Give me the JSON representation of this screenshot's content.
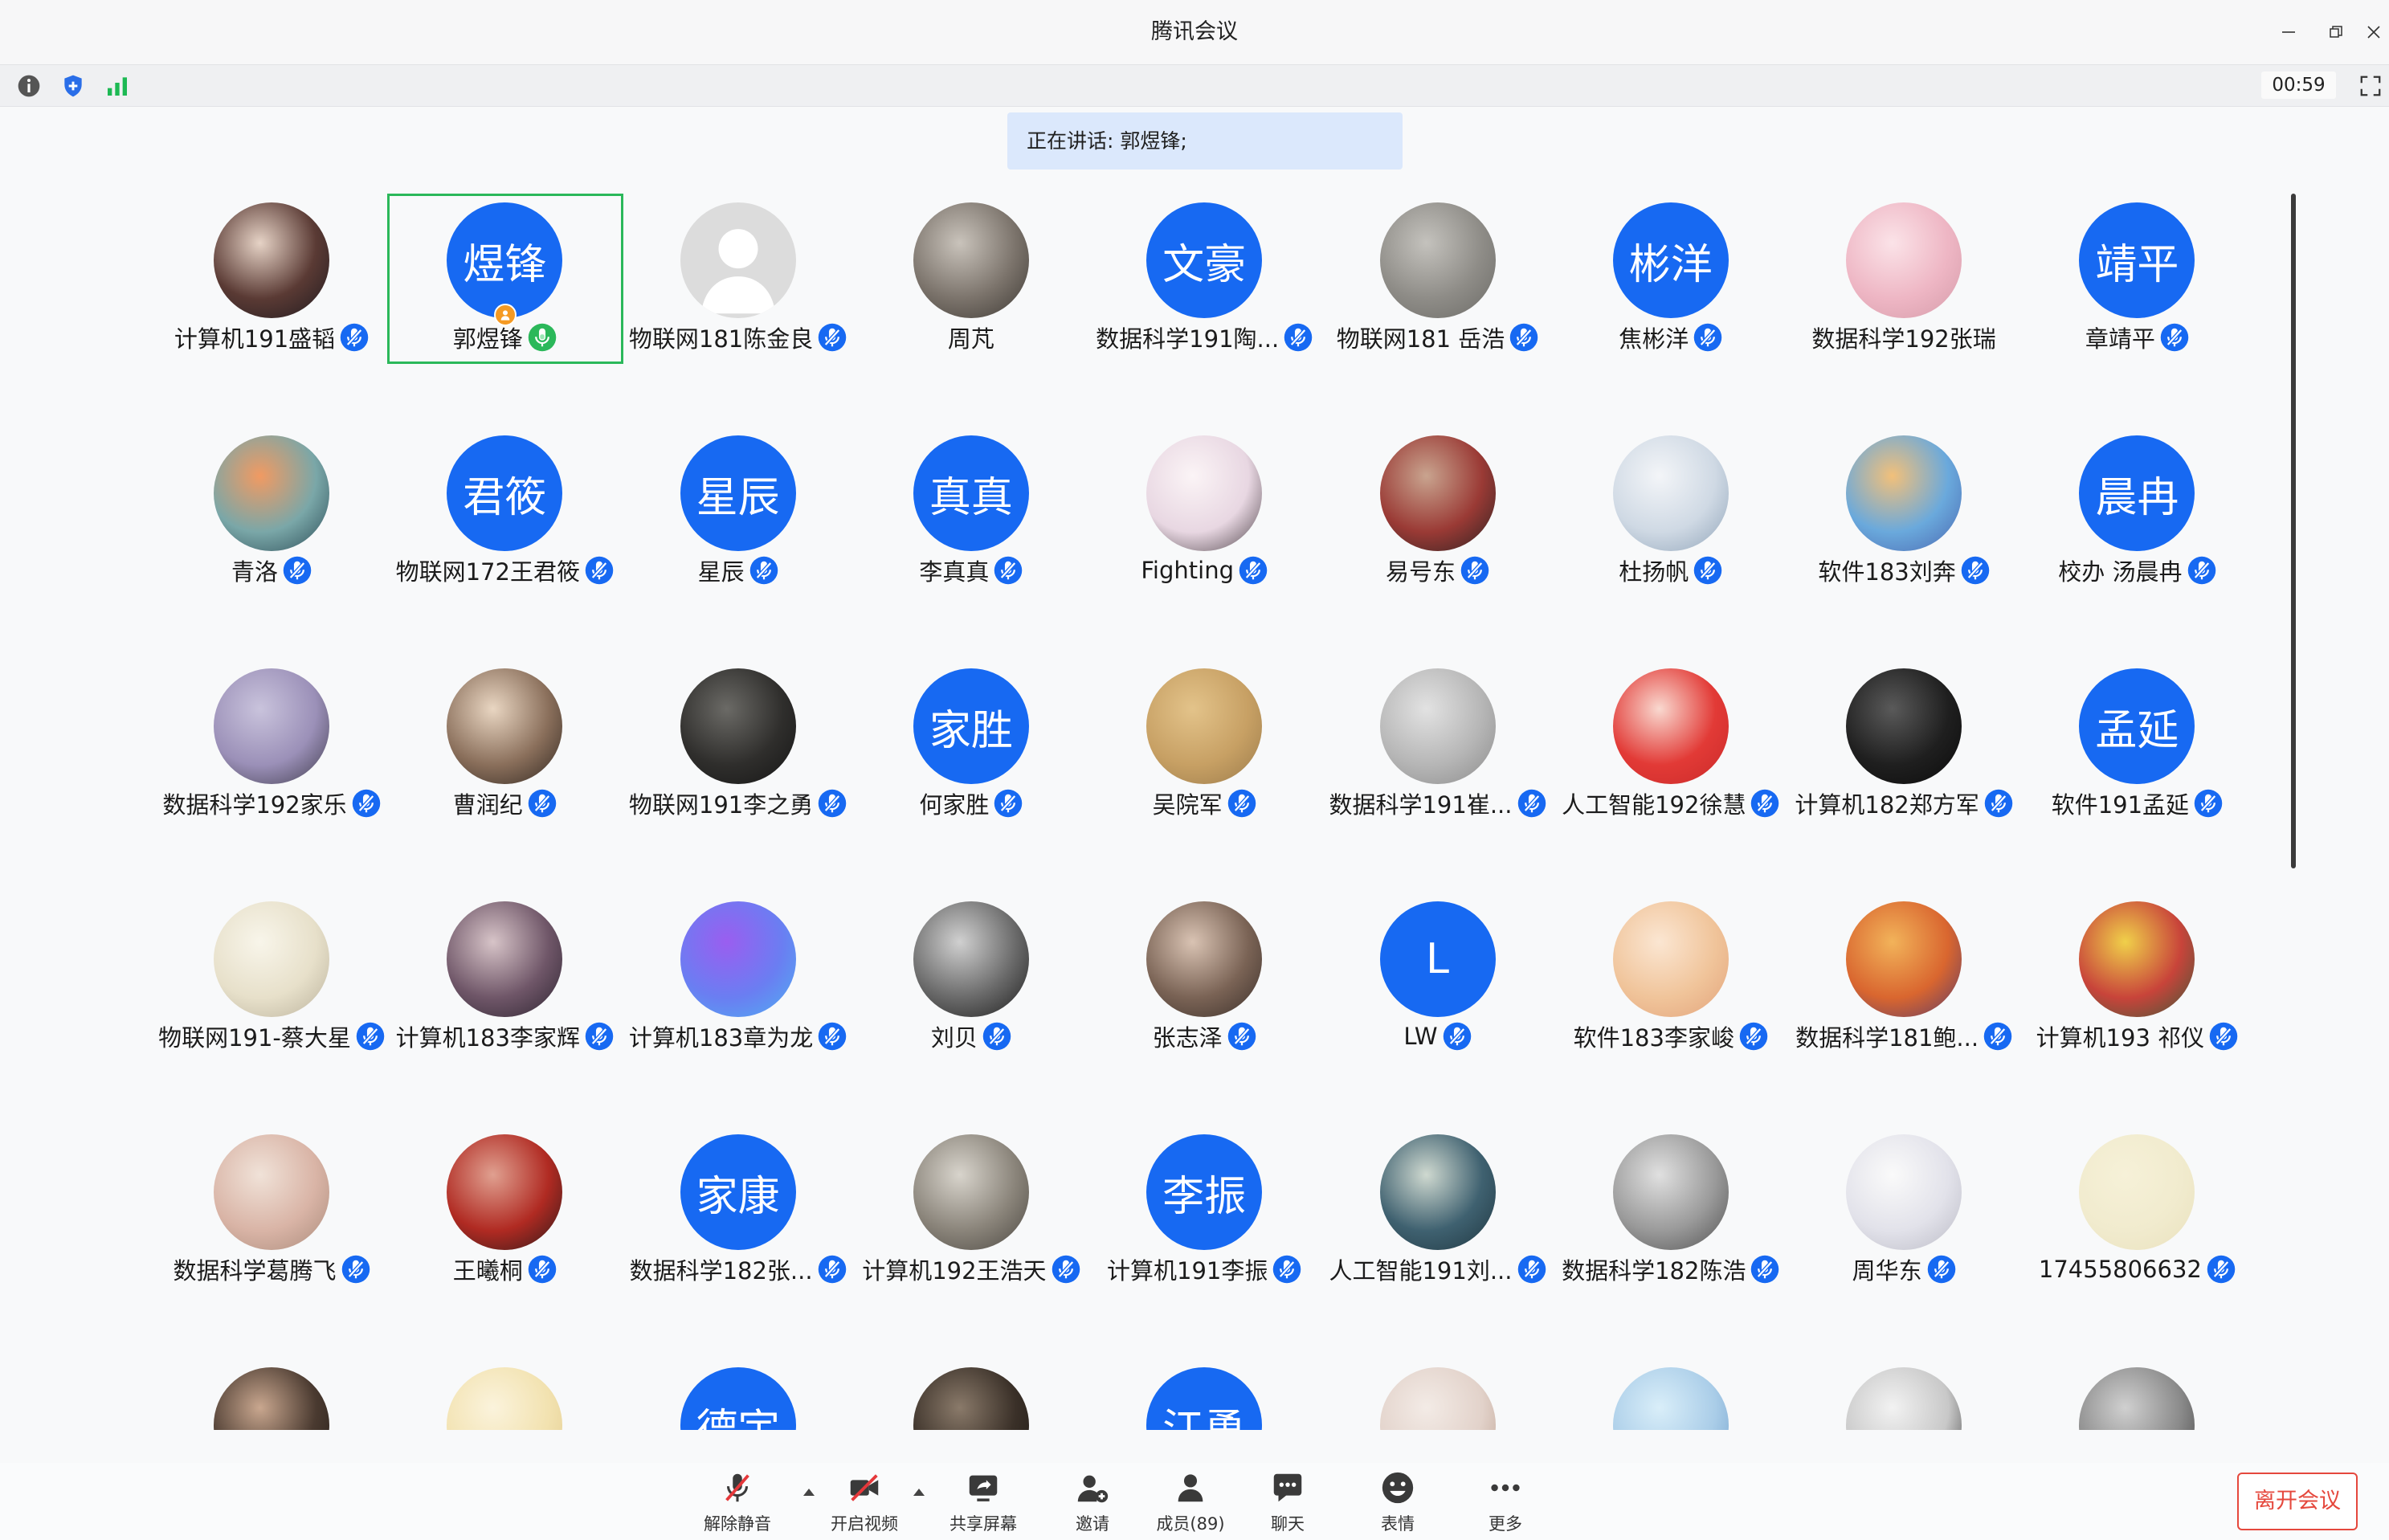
{
  "window": {
    "title": "腾讯会议"
  },
  "info_bar": {
    "timer": "00:59"
  },
  "speaking": {
    "label": "正在讲话: 郭煜锋;"
  },
  "colors": {
    "accent": "#1769f2",
    "speaking": "#2bb85a",
    "host": "#f59a23",
    "leave": "#e5483d",
    "banner": "#dbe8fc"
  },
  "participants": [
    {
      "name": "计算机191盛韬",
      "mic": "muted",
      "avatar": {
        "type": "photo",
        "colors": [
          "#e6d3c6",
          "#5a3a34",
          "#1e1a1f"
        ]
      }
    },
    {
      "name": "郭煜锋",
      "mic": "speaking",
      "host": true,
      "active": true,
      "avatar": {
        "type": "text",
        "text": "煜锋"
      }
    },
    {
      "name": "物联网181陈金良",
      "mic": "muted",
      "avatar": {
        "type": "default"
      }
    },
    {
      "name": "周芃",
      "avatar": {
        "type": "photo",
        "colors": [
          "#c9c3bb",
          "#7b736b",
          "#3c3833"
        ]
      }
    },
    {
      "name": "数据科学191陶...",
      "mic": "muted",
      "avatar": {
        "type": "text",
        "text": "文豪"
      }
    },
    {
      "name": "物联网181 岳浩",
      "mic": "muted",
      "avatar": {
        "type": "photo",
        "colors": [
          "#c4c2bd",
          "#8e8c87",
          "#6b6a66"
        ]
      }
    },
    {
      "name": "焦彬洋",
      "mic": "muted",
      "avatar": {
        "type": "text",
        "text": "彬洋"
      }
    },
    {
      "name": "数据科学192张瑞",
      "avatar": {
        "type": "photo",
        "colors": [
          "#fbe3e8",
          "#eeb6c4",
          "#d49aa8"
        ]
      }
    },
    {
      "name": "章靖平",
      "mic": "muted",
      "avatar": {
        "type": "text",
        "text": "靖平"
      }
    },
    {
      "name": "青洛",
      "mic": "muted",
      "avatar": {
        "type": "photo",
        "colors": [
          "#f19a62",
          "#7aa7a8",
          "#2a4a55"
        ]
      }
    },
    {
      "name": "物联网172王君筱",
      "mic": "muted",
      "avatar": {
        "type": "text",
        "text": "君筱"
      }
    },
    {
      "name": "星辰",
      "mic": "muted",
      "avatar": {
        "type": "text",
        "text": "星辰"
      }
    },
    {
      "name": "李真真",
      "mic": "muted",
      "avatar": {
        "type": "text",
        "text": "真真"
      }
    },
    {
      "name": "Fighting",
      "mic": "muted",
      "avatar": {
        "type": "photo",
        "colors": [
          "#fbf4f6",
          "#e8d7e2",
          "#4b4046"
        ]
      }
    },
    {
      "name": "易号东",
      "mic": "muted",
      "avatar": {
        "type": "photo",
        "colors": [
          "#c9a48f",
          "#9a3a35",
          "#2a2222"
        ]
      }
    },
    {
      "name": "杜扬帆",
      "mic": "muted",
      "avatar": {
        "type": "photo",
        "colors": [
          "#f3f5f8",
          "#cfd9e4",
          "#8fa3b8"
        ]
      }
    },
    {
      "name": "软件183刘奔",
      "mic": "muted",
      "avatar": {
        "type": "photo",
        "colors": [
          "#f2c07a",
          "#6aa9dc",
          "#4a66b0"
        ]
      }
    },
    {
      "name": "校办 汤晨冉",
      "mic": "muted",
      "avatar": {
        "type": "text",
        "text": "晨冉"
      }
    },
    {
      "name": "数据科学192家乐",
      "mic": "muted",
      "avatar": {
        "type": "photo",
        "colors": [
          "#c9c3dc",
          "#9b90b8",
          "#3e3a4a"
        ]
      }
    },
    {
      "name": "曹润纪",
      "mic": "muted",
      "avatar": {
        "type": "photo",
        "colors": [
          "#e9d6c2",
          "#8a6f5b",
          "#2f2620"
        ]
      }
    },
    {
      "name": "物联网191李之勇",
      "mic": "muted",
      "avatar": {
        "type": "photo",
        "colors": [
          "#6b6a66",
          "#2f2e2c",
          "#151515"
        ]
      }
    },
    {
      "name": "何家胜",
      "mic": "muted",
      "avatar": {
        "type": "text",
        "text": "家胜"
      }
    },
    {
      "name": "吴院军",
      "mic": "muted",
      "avatar": {
        "type": "photo",
        "colors": [
          "#e3c38a",
          "#c7a064",
          "#9a7a4a"
        ]
      }
    },
    {
      "name": "数据科学191崔...",
      "mic": "muted",
      "avatar": {
        "type": "photo",
        "colors": [
          "#e2e2e2",
          "#b6b6b6",
          "#8a8a8a"
        ]
      }
    },
    {
      "name": "人工智能192徐慧",
      "mic": "muted",
      "avatar": {
        "type": "photo",
        "colors": [
          "#f9d9d0",
          "#e23a36",
          "#c92a2a"
        ]
      }
    },
    {
      "name": "计算机182郑方军",
      "mic": "muted",
      "avatar": {
        "type": "photo",
        "colors": [
          "#5a5a5a",
          "#1f1f1f",
          "#0a0a0a"
        ]
      }
    },
    {
      "name": "软件191孟延",
      "mic": "muted",
      "avatar": {
        "type": "text",
        "text": "孟延"
      }
    },
    {
      "name": "物联网191-蔡大星",
      "mic": "muted",
      "avatar": {
        "type": "photo",
        "colors": [
          "#f8f5ea",
          "#e7e0ca",
          "#b9b09a"
        ]
      }
    },
    {
      "name": "计算机183李家辉",
      "mic": "muted",
      "avatar": {
        "type": "photo",
        "colors": [
          "#d7c4c8",
          "#6f5668",
          "#2c2430"
        ]
      }
    },
    {
      "name": "计算机183章为龙",
      "mic": "muted",
      "avatar": {
        "type": "photo",
        "colors": [
          "#9a5ef0",
          "#6a7ef2",
          "#4fb0f2"
        ]
      }
    },
    {
      "name": "刘贝",
      "mic": "muted",
      "avatar": {
        "type": "photo",
        "colors": [
          "#d0d0d0",
          "#6a6a6a",
          "#1c1c1c"
        ]
      }
    },
    {
      "name": "张志泽",
      "mic": "muted",
      "avatar": {
        "type": "photo",
        "colors": [
          "#d9c3b3",
          "#7a6355",
          "#3a2f2a"
        ]
      }
    },
    {
      "name": "LW",
      "mic": "muted",
      "avatar": {
        "type": "text",
        "text": "L"
      }
    },
    {
      "name": "软件183李家峻",
      "mic": "muted",
      "avatar": {
        "type": "photo",
        "colors": [
          "#fbe6d2",
          "#f0c49a",
          "#e2a27a"
        ]
      }
    },
    {
      "name": "数据科学181鲍...",
      "mic": "muted",
      "avatar": {
        "type": "photo",
        "colors": [
          "#f2b35a",
          "#d9662f",
          "#5a3a6a"
        ]
      }
    },
    {
      "name": "计算机193 祁仪",
      "mic": "muted",
      "avatar": {
        "type": "photo",
        "colors": [
          "#f0d04a",
          "#c8443a",
          "#3a5a3a"
        ]
      }
    },
    {
      "name": "数据科学葛腾飞",
      "mic": "muted",
      "avatar": {
        "type": "photo",
        "colors": [
          "#f0e2d8",
          "#d9b4a6",
          "#a98a7a"
        ]
      }
    },
    {
      "name": "王曦桐",
      "mic": "muted",
      "avatar": {
        "type": "photo",
        "colors": [
          "#e0a090",
          "#b02a22",
          "#2a1a1a"
        ]
      }
    },
    {
      "name": "数据科学182张...",
      "mic": "muted",
      "avatar": {
        "type": "text",
        "text": "家康"
      }
    },
    {
      "name": "计算机192王浩天",
      "mic": "muted",
      "avatar": {
        "type": "photo",
        "colors": [
          "#d8d4cc",
          "#8a847a",
          "#4a4640"
        ]
      }
    },
    {
      "name": "计算机191李振",
      "mic": "muted",
      "avatar": {
        "type": "text",
        "text": "李振"
      }
    },
    {
      "name": "人工智能191刘...",
      "mic": "muted",
      "avatar": {
        "type": "photo",
        "colors": [
          "#cfd9d0",
          "#3f6170",
          "#1f3640"
        ]
      }
    },
    {
      "name": "数据科学182陈浩",
      "mic": "muted",
      "avatar": {
        "type": "photo",
        "colors": [
          "#e0e0e0",
          "#9a9a9a",
          "#505050"
        ]
      }
    },
    {
      "name": "周华东",
      "mic": "muted",
      "avatar": {
        "type": "photo",
        "colors": [
          "#fafafa",
          "#e2e2ea",
          "#b9b9c4"
        ]
      }
    },
    {
      "name": "17455806632",
      "mic": "muted",
      "avatar": {
        "type": "photo",
        "colors": [
          "#f6f1d8",
          "#f1ebce",
          "#e9e1bd"
        ]
      }
    },
    {
      "avatar": {
        "type": "photo",
        "colors": [
          "#c9a78f",
          "#4a3a30",
          "#1e1814"
        ]
      }
    },
    {
      "avatar": {
        "type": "photo",
        "colors": [
          "#fbf3dc",
          "#f2e2b0",
          "#e0c88a"
        ]
      }
    },
    {
      "avatar": {
        "type": "text",
        "text": "德宇"
      }
    },
    {
      "avatar": {
        "type": "photo",
        "colors": [
          "#8a7a6a",
          "#3a3028",
          "#1a1612"
        ]
      }
    },
    {
      "avatar": {
        "type": "text",
        "text": "江勇"
      }
    },
    {
      "avatar": {
        "type": "photo",
        "colors": [
          "#f3ebe6",
          "#e2d2ca",
          "#b89a8a"
        ]
      }
    },
    {
      "avatar": {
        "type": "photo",
        "colors": [
          "#d9eef9",
          "#aacde8",
          "#6a9ac8"
        ]
      }
    },
    {
      "avatar": {
        "type": "photo",
        "colors": [
          "#f2f2f2",
          "#c8c8c8",
          "#303030"
        ]
      }
    },
    {
      "avatar": {
        "type": "photo",
        "colors": [
          "#d0d0d0",
          "#8a8a8a",
          "#3a3a3a"
        ]
      }
    }
  ],
  "toolbar": {
    "items": [
      {
        "label": "解除静音",
        "icon": "mic-muted-icon"
      },
      {
        "label": "开启视频",
        "icon": "video-off-icon"
      },
      {
        "label": "共享屏幕",
        "icon": "share-screen-icon"
      },
      {
        "label": "邀请",
        "icon": "invite-icon"
      },
      {
        "label": "成员(89)",
        "icon": "members-icon"
      },
      {
        "label": "聊天",
        "icon": "chat-icon"
      },
      {
        "label": "表情",
        "icon": "emoji-icon"
      },
      {
        "label": "更多",
        "icon": "more-icon"
      }
    ],
    "leave_label": "离开会议"
  }
}
